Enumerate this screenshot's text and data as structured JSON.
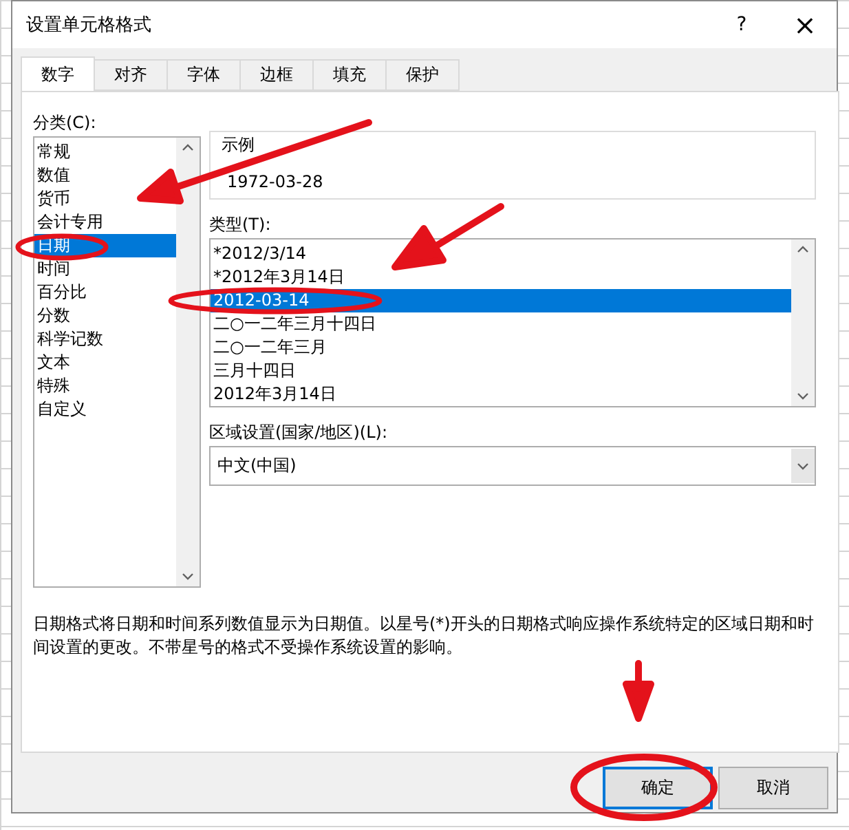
{
  "window": {
    "title": "设置单元格格式",
    "help": "?",
    "close": "×"
  },
  "tabs": [
    {
      "label": "数字",
      "selected": true
    },
    {
      "label": "对齐",
      "selected": false
    },
    {
      "label": "字体",
      "selected": false
    },
    {
      "label": "边框",
      "selected": false
    },
    {
      "label": "填充",
      "selected": false
    },
    {
      "label": "保护",
      "selected": false
    }
  ],
  "category": {
    "label": "分类(C):",
    "items": [
      {
        "label": "常规",
        "selected": false
      },
      {
        "label": "数值",
        "selected": false
      },
      {
        "label": "货币",
        "selected": false
      },
      {
        "label": "会计专用",
        "selected": false
      },
      {
        "label": "日期",
        "selected": true
      },
      {
        "label": "时间",
        "selected": false
      },
      {
        "label": "百分比",
        "selected": false
      },
      {
        "label": "分数",
        "selected": false
      },
      {
        "label": "科学记数",
        "selected": false
      },
      {
        "label": "文本",
        "selected": false
      },
      {
        "label": "特殊",
        "selected": false
      },
      {
        "label": "自定义",
        "selected": false
      }
    ]
  },
  "sample": {
    "label": "示例",
    "value": "1972-03-28"
  },
  "type": {
    "label": "类型(T):",
    "items": [
      {
        "label": "*2012/3/14",
        "selected": false
      },
      {
        "label": "*2012年3月14日",
        "selected": false
      },
      {
        "label": "2012-03-14",
        "selected": true
      },
      {
        "label": "二○一二年三月十四日",
        "selected": false
      },
      {
        "label": "二○一二年三月",
        "selected": false
      },
      {
        "label": "三月十四日",
        "selected": false
      },
      {
        "label": "2012年3月14日",
        "selected": false
      }
    ]
  },
  "locale": {
    "label": "区域设置(国家/地区)(L):",
    "value": "中文(中国)"
  },
  "description": "日期格式将日期和时间系列数值显示为日期值。以星号(*)开头的日期格式响应操作系统特定的区域日期和时间设置的更改。不带星号的格式不受操作系统设置的影响。",
  "buttons": [
    {
      "label": "确定",
      "kind": "primary"
    },
    {
      "label": "取消",
      "kind": "secondary"
    }
  ]
}
